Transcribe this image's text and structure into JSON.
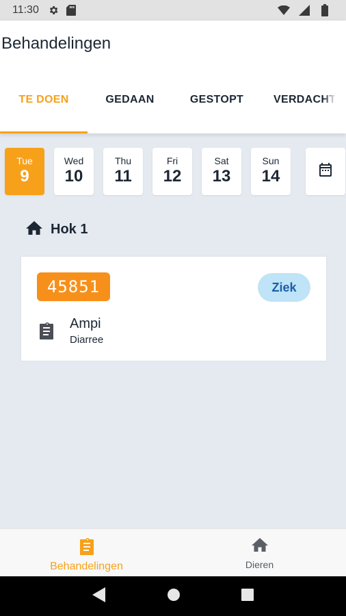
{
  "status_bar": {
    "time": "11:30",
    "icons": [
      "settings-icon",
      "sd-card-icon",
      "wifi-icon",
      "signal-icon",
      "battery-icon"
    ]
  },
  "app_bar": {
    "title": "Behandelingen"
  },
  "tabs": [
    {
      "label": "TE DOEN",
      "active": true
    },
    {
      "label": "GEDAAN",
      "active": false
    },
    {
      "label": "GESTOPT",
      "active": false
    },
    {
      "label": "VERDACHT",
      "active": false
    }
  ],
  "dates": [
    {
      "day": "Tue",
      "num": "9",
      "active": true
    },
    {
      "day": "Wed",
      "num": "10",
      "active": false
    },
    {
      "day": "Thu",
      "num": "11",
      "active": false
    },
    {
      "day": "Fri",
      "num": "12",
      "active": false
    },
    {
      "day": "Sat",
      "num": "13",
      "active": false
    },
    {
      "day": "Sun",
      "num": "14",
      "active": false
    }
  ],
  "calendar_icon": "calendar-icon",
  "section": {
    "icon": "home-icon",
    "title": "Hok 1"
  },
  "card": {
    "animal_id": "45851",
    "status": "Ziek",
    "treatment_icon": "clipboard-icon",
    "treatment_name": "Ampi",
    "treatment_desc": "Diarree"
  },
  "bottom_nav": [
    {
      "label": "Behandelingen",
      "icon": "clipboard-icon",
      "active": true
    },
    {
      "label": "Dieren",
      "icon": "home-icon",
      "active": false
    }
  ],
  "colors": {
    "accent": "#f7a11a",
    "id_badge": "#f7901a",
    "chip_bg": "#bfe3f7",
    "chip_text": "#1c5ea8",
    "background": "#e5eaf0",
    "text": "#1c2733"
  }
}
